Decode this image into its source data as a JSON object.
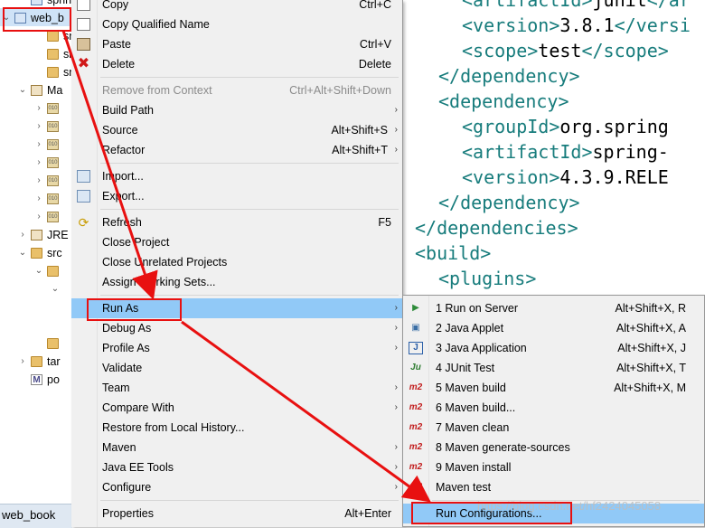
{
  "tree": {
    "rows": [
      {
        "label": "spring",
        "indent": 1,
        "icon": "project-icon",
        "arrow": ""
      },
      {
        "label": "web_b",
        "indent": 0,
        "icon": "project-icon",
        "arrow": "down"
      },
      {
        "label": "src",
        "indent": 2,
        "icon": "folder-icon",
        "arrow": ""
      },
      {
        "label": "src",
        "indent": 2,
        "icon": "folder-icon",
        "arrow": ""
      },
      {
        "label": "src",
        "indent": 2,
        "icon": "folder-icon",
        "arrow": ""
      },
      {
        "label": "Ma",
        "indent": 1,
        "icon": "library-icon",
        "arrow": "down"
      },
      {
        "label": "",
        "indent": 2,
        "icon": "jar-icon",
        "arrow": "right"
      },
      {
        "label": "",
        "indent": 2,
        "icon": "jar-icon",
        "arrow": "right"
      },
      {
        "label": "",
        "indent": 2,
        "icon": "jar-icon",
        "arrow": "right"
      },
      {
        "label": "",
        "indent": 2,
        "icon": "jar-icon",
        "arrow": "right"
      },
      {
        "label": "",
        "indent": 2,
        "icon": "jar-icon",
        "arrow": "right"
      },
      {
        "label": "",
        "indent": 2,
        "icon": "jar-icon",
        "arrow": "right"
      },
      {
        "label": "",
        "indent": 2,
        "icon": "jar-icon",
        "arrow": "right"
      },
      {
        "label": "JRE",
        "indent": 1,
        "icon": "library-icon",
        "arrow": "right"
      },
      {
        "label": "src",
        "indent": 1,
        "icon": "folder-icon",
        "arrow": "down"
      },
      {
        "label": "",
        "indent": 2,
        "icon": "folder-icon",
        "arrow": "down"
      },
      {
        "label": "",
        "indent": 3,
        "icon": "",
        "arrow": "down"
      },
      {
        "label": "",
        "indent": 3,
        "icon": "",
        "arrow": ""
      },
      {
        "label": "",
        "indent": 3,
        "icon": "",
        "arrow": ""
      },
      {
        "label": "",
        "indent": 2,
        "icon": "folder-icon",
        "arrow": ""
      },
      {
        "label": "tar",
        "indent": 1,
        "icon": "folder-icon",
        "arrow": "right"
      },
      {
        "label": "po",
        "indent": 1,
        "icon": "pom-icon",
        "arrow": ""
      }
    ],
    "status_label": "web_book"
  },
  "editor": {
    "lines": [
      {
        "indent": 2,
        "parts": [
          [
            "tag",
            "<artifactId>"
          ],
          [
            "text",
            "junit"
          ],
          [
            "tag",
            "</ar"
          ]
        ]
      },
      {
        "indent": 2,
        "parts": [
          [
            "tag",
            "<version>"
          ],
          [
            "text",
            "3.8.1"
          ],
          [
            "tag",
            "</versi"
          ]
        ]
      },
      {
        "indent": 2,
        "parts": [
          [
            "tag",
            "<scope>"
          ],
          [
            "text",
            "test"
          ],
          [
            "tag",
            "</scope>"
          ]
        ]
      },
      {
        "indent": 1,
        "parts": [
          [
            "tag",
            "</dependency>"
          ]
        ]
      },
      {
        "indent": 1,
        "parts": [
          [
            "tag",
            "<dependency>"
          ]
        ]
      },
      {
        "indent": 2,
        "parts": [
          [
            "tag",
            "<groupId>"
          ],
          [
            "text",
            "org.spring"
          ]
        ]
      },
      {
        "indent": 2,
        "parts": [
          [
            "tag",
            "<artifactId>"
          ],
          [
            "text",
            "spring-"
          ]
        ]
      },
      {
        "indent": 2,
        "parts": [
          [
            "tag",
            "<version>"
          ],
          [
            "text",
            "4.3.9.RELE"
          ]
        ]
      },
      {
        "indent": 1,
        "parts": [
          [
            "tag",
            "</dependency>"
          ]
        ]
      },
      {
        "indent": 0,
        "parts": [
          [
            "tag",
            "</dependencies>"
          ]
        ]
      },
      {
        "indent": 0,
        "parts": [
          [
            "tag",
            "<build>"
          ]
        ]
      },
      {
        "indent": 1,
        "parts": [
          [
            "tag",
            "<plugins>"
          ]
        ]
      }
    ]
  },
  "menu": {
    "items": [
      {
        "type": "item",
        "label": "Copy",
        "shortcut": "Ctrl+C",
        "icon": "copy-icon"
      },
      {
        "type": "item",
        "label": "Copy Qualified Name",
        "shortcut": "",
        "icon": "copy-qualified-icon"
      },
      {
        "type": "item",
        "label": "Paste",
        "shortcut": "Ctrl+V",
        "icon": "paste-icon"
      },
      {
        "type": "item",
        "label": "Delete",
        "shortcut": "Delete",
        "icon": "delete-icon"
      },
      {
        "type": "sep"
      },
      {
        "type": "item",
        "label": "Remove from Context",
        "shortcut": "Ctrl+Alt+Shift+Down",
        "disabled": true
      },
      {
        "type": "item",
        "label": "Build Path",
        "submenu": true
      },
      {
        "type": "item",
        "label": "Source",
        "shortcut": "Alt+Shift+S",
        "submenu": true
      },
      {
        "type": "item",
        "label": "Refactor",
        "shortcut": "Alt+Shift+T",
        "submenu": true
      },
      {
        "type": "sep"
      },
      {
        "type": "item",
        "label": "Import...",
        "icon": "import-icon"
      },
      {
        "type": "item",
        "label": "Export...",
        "icon": "export-icon"
      },
      {
        "type": "sep"
      },
      {
        "type": "item",
        "label": "Refresh",
        "shortcut": "F5",
        "icon": "refresh-icon"
      },
      {
        "type": "item",
        "label": "Close Project"
      },
      {
        "type": "item",
        "label": "Close Unrelated Projects"
      },
      {
        "type": "item",
        "label": "Assign Working Sets..."
      },
      {
        "type": "sep"
      },
      {
        "type": "item",
        "label": "Run As",
        "submenu": true,
        "highlighted": true
      },
      {
        "type": "item",
        "label": "Debug As",
        "submenu": true
      },
      {
        "type": "item",
        "label": "Profile As",
        "submenu": true
      },
      {
        "type": "item",
        "label": "Validate"
      },
      {
        "type": "item",
        "label": "Team",
        "submenu": true
      },
      {
        "type": "item",
        "label": "Compare With",
        "submenu": true
      },
      {
        "type": "item",
        "label": "Restore from Local History..."
      },
      {
        "type": "item",
        "label": "Maven",
        "submenu": true
      },
      {
        "type": "item",
        "label": "Java EE Tools",
        "submenu": true
      },
      {
        "type": "item",
        "label": "Configure",
        "submenu": true
      },
      {
        "type": "sep"
      },
      {
        "type": "item",
        "label": "Properties",
        "shortcut": "Alt+Enter"
      }
    ]
  },
  "submenu": {
    "items": [
      {
        "type": "item",
        "label": "1 Run on Server",
        "shortcut": "Alt+Shift+X, R",
        "icon": "server-icon",
        "mark": "▶"
      },
      {
        "type": "item",
        "label": "2 Java Applet",
        "shortcut": "Alt+Shift+X, A",
        "icon": "applet-icon",
        "mark": "▣"
      },
      {
        "type": "item",
        "label": "3 Java Application",
        "shortcut": "Alt+Shift+X, J",
        "icon": "java-app-icon",
        "mark": "J"
      },
      {
        "type": "item",
        "label": "4 JUnit Test",
        "shortcut": "Alt+Shift+X, T",
        "icon": "junit-icon",
        "mark": "Ju"
      },
      {
        "type": "item",
        "label": "5 Maven build",
        "shortcut": "Alt+Shift+X, M",
        "icon": "maven-icon",
        "mark": "m2"
      },
      {
        "type": "item",
        "label": "6 Maven build...",
        "icon": "maven-icon",
        "mark": "m2"
      },
      {
        "type": "item",
        "label": "7 Maven clean",
        "icon": "maven-icon",
        "mark": "m2"
      },
      {
        "type": "item",
        "label": "8 Maven generate-sources",
        "icon": "maven-icon",
        "mark": "m2"
      },
      {
        "type": "item",
        "label": "9 Maven install",
        "icon": "maven-icon",
        "mark": "m2"
      },
      {
        "type": "item",
        "label": "Maven test",
        "icon": "maven-icon",
        "mark": "m2"
      },
      {
        "type": "sep"
      },
      {
        "type": "item",
        "label": "Run Configurations...",
        "highlighted": true
      }
    ]
  },
  "watermark": "https://blog.csdn.net/hf2424045058",
  "colors": {
    "highlight": "#91c9f7",
    "annotation": "#e81010",
    "xml_tag": "#177c7c"
  }
}
